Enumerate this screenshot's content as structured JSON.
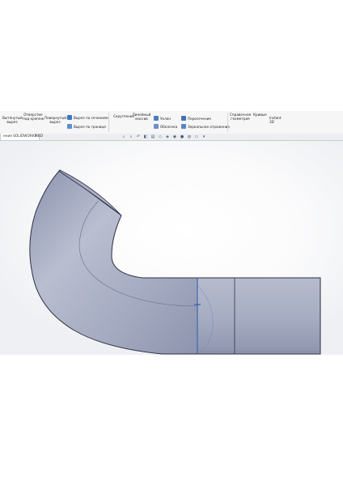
{
  "ribbon": {
    "items": [
      {
        "label_l1": "Вытянутый",
        "label_l2": "вырез"
      },
      {
        "label_l1": "Отверстие",
        "label_l2": "под крепеж"
      },
      {
        "label_l1": "Повернутый",
        "label_l2": "вырез"
      },
      {
        "label": "Вырез по сечениям"
      },
      {
        "label": "Вырез по границе"
      },
      {
        "label": "Скругление"
      },
      {
        "label_l1": "Линейный",
        "label_l2": "массив"
      },
      {
        "label": "Уклон"
      },
      {
        "label": "Оболочка"
      },
      {
        "label": "Пересечение"
      },
      {
        "label": "Зеркальное отражение"
      },
      {
        "label_l1": "Справочная",
        "label_l2": "геометрия"
      },
      {
        "label": "Кривые"
      },
      {
        "label_l1": "Instant",
        "label_l2": "3D"
      }
    ]
  },
  "tabs": [
    {
      "label": "ения SOLIDWORKS"
    },
    {
      "label": "MBD"
    }
  ],
  "view_toolbar": {
    "icons": [
      "zoom-to-fit-icon",
      "zoom-area-icon",
      "previous-view-icon",
      "section-view-icon",
      "dynamic-annotation-icon",
      "view-orientation-icon",
      "display-style-icon",
      "hide-show-icon",
      "edit-appearance-icon",
      "apply-scene-icon",
      "view-settings-icon",
      "display-icon"
    ]
  },
  "colors": {
    "accent": "#2a5db0",
    "part_fill": "#a9afc4",
    "part_edge": "#2d3146"
  }
}
